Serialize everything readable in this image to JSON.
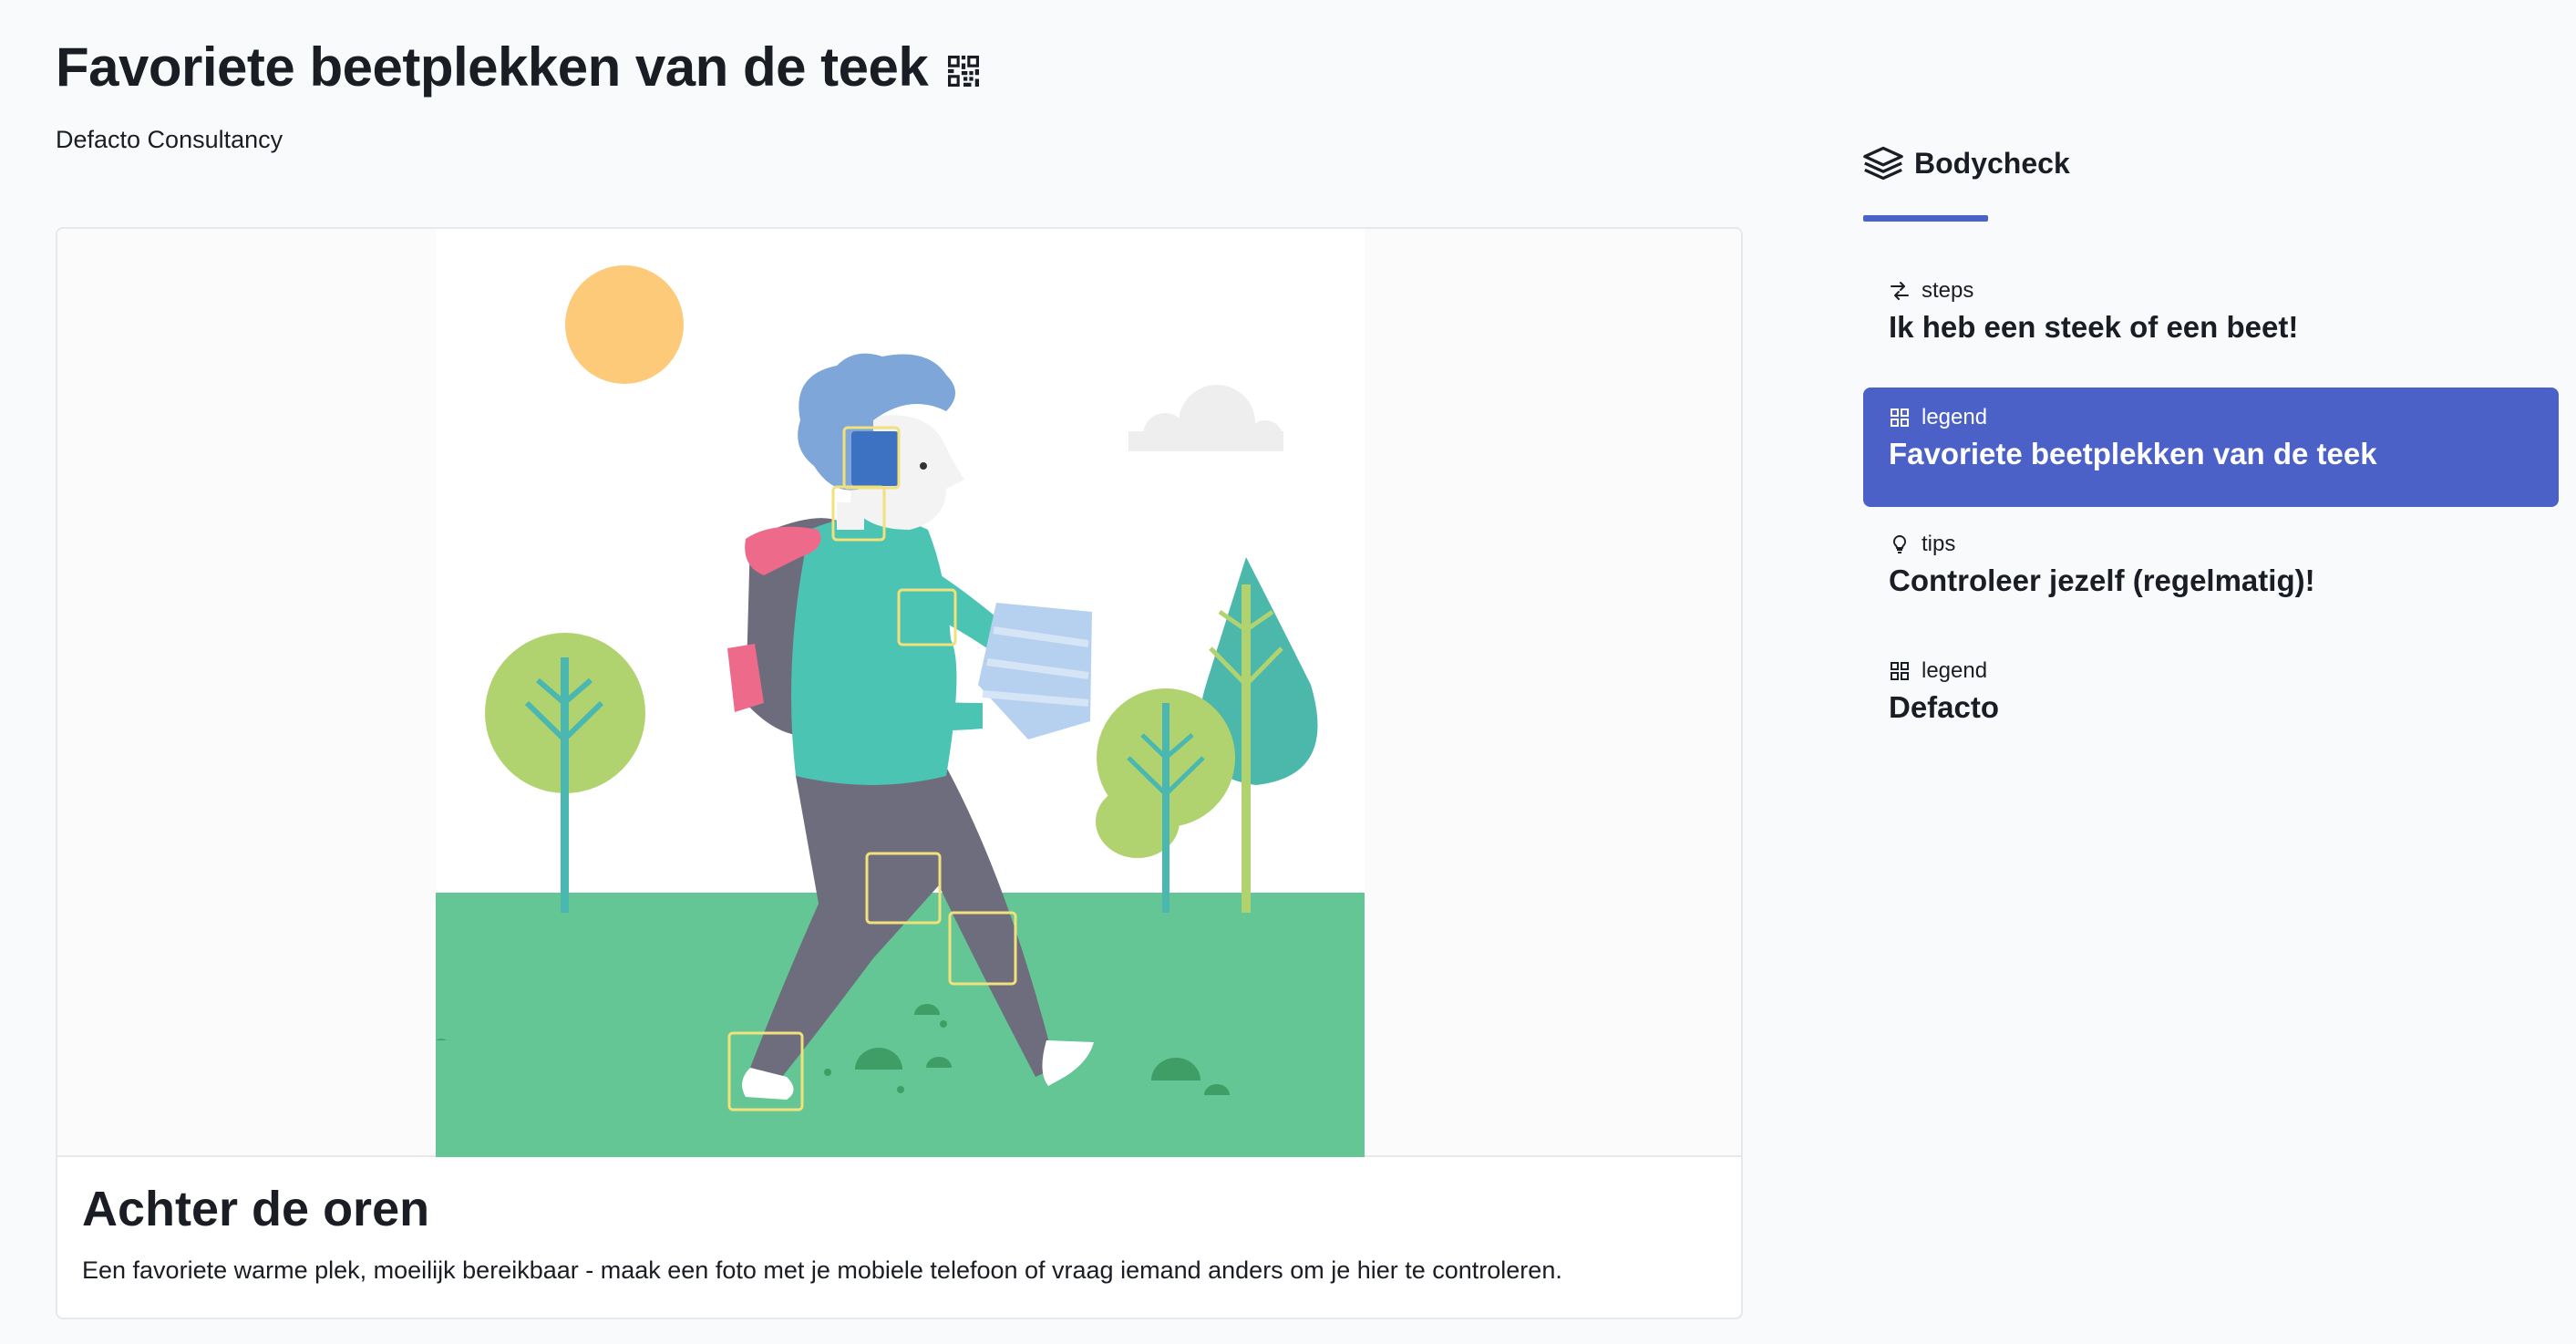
{
  "header": {
    "title": "Favoriete beetplekken van de teek",
    "subtitle": "Defacto Consultancy"
  },
  "card": {
    "title": "Achter de oren",
    "description": "Een favoriete warme plek, moeilijk bereikbaar - maak een foto met je mobiele telefoon of vraag iemand anders om je hier te controleren."
  },
  "sidebar": {
    "heading": "Bodycheck",
    "items": [
      {
        "kind": "steps",
        "icon": "steps-icon",
        "title": "Ik heb een steek of een beet!"
      },
      {
        "kind": "legend",
        "icon": "legend-icon",
        "title": "Favoriete beetplekken van de teek",
        "active": true
      },
      {
        "kind": "tips",
        "icon": "lightbulb-icon",
        "title": "Controleer jezelf (regelmatig)!"
      },
      {
        "kind": "legend",
        "icon": "legend-icon",
        "title": "Defacto"
      }
    ]
  },
  "colors": {
    "accent": "#4b61c8",
    "grass": "#63c694",
    "hotspot": "#f2e17a"
  }
}
